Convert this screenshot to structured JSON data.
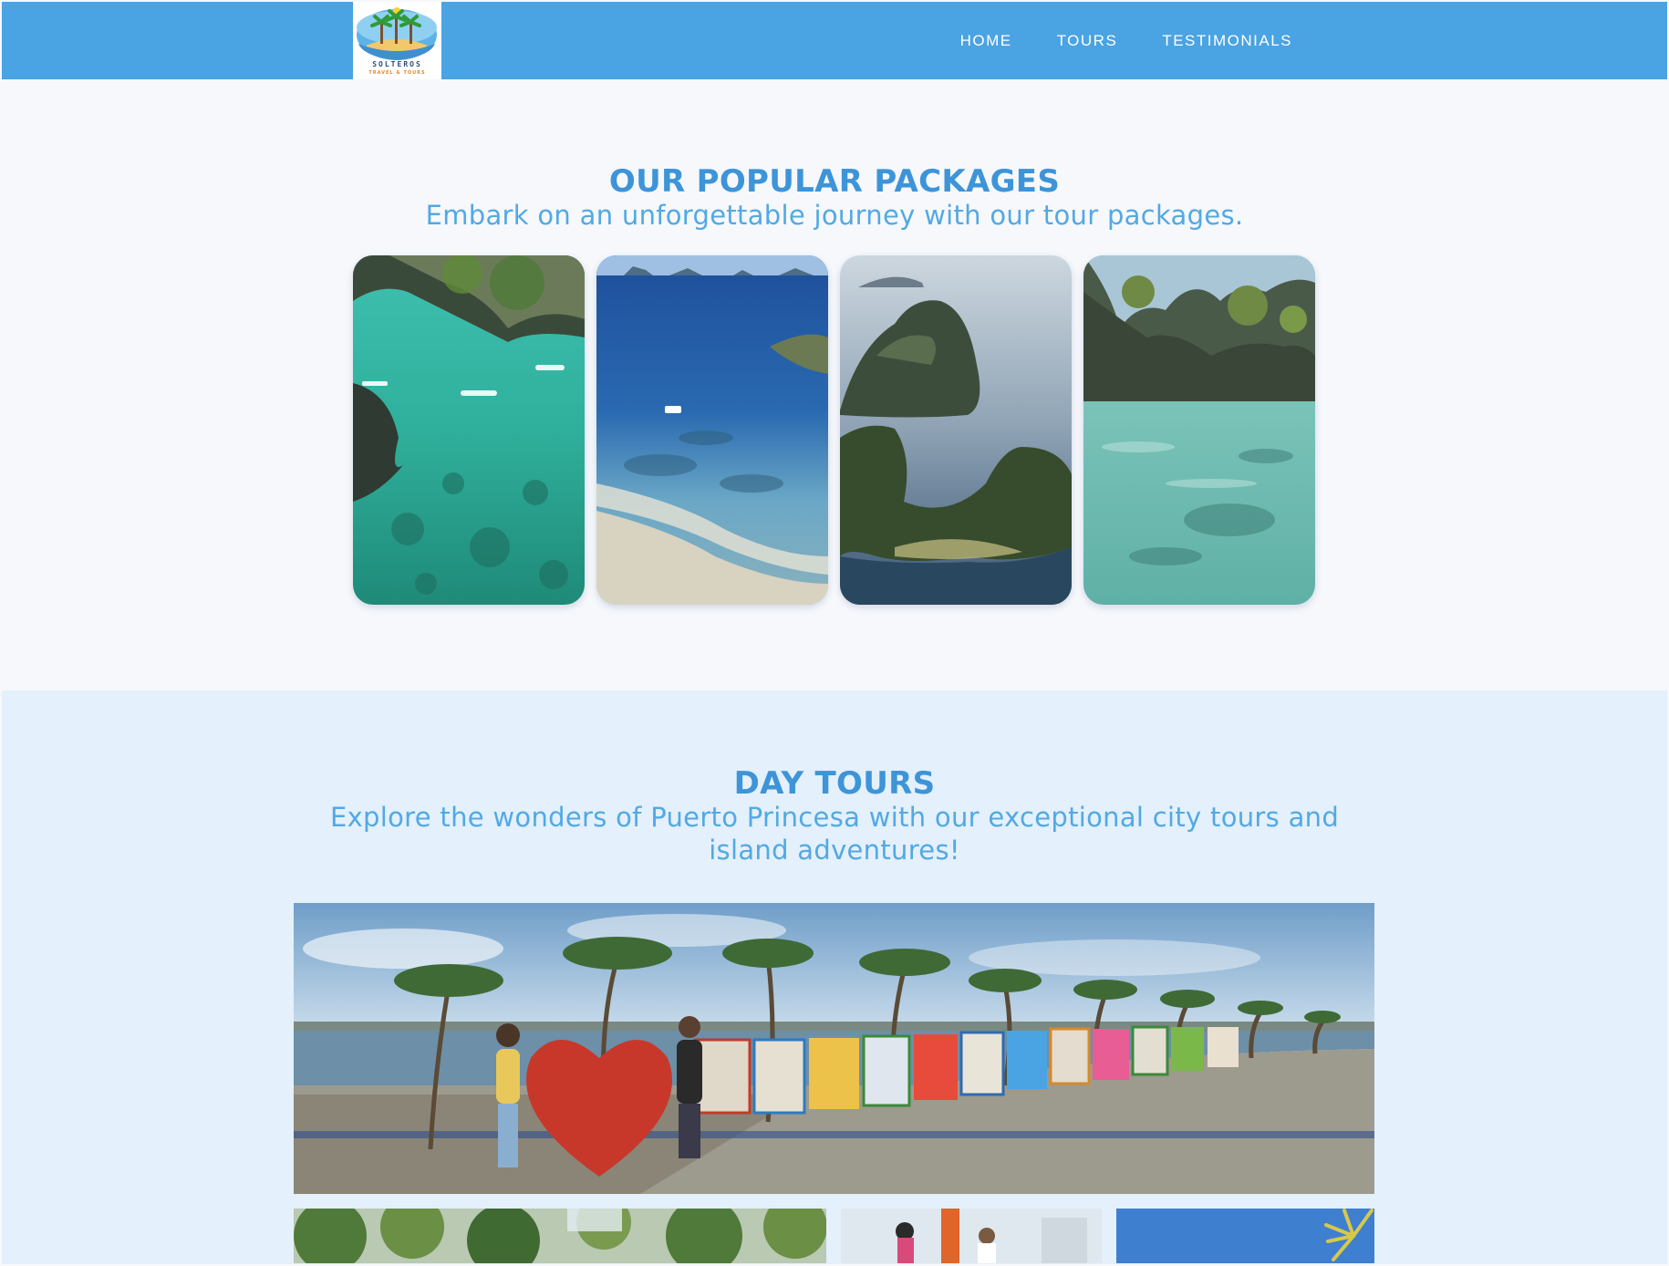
{
  "brand": {
    "logo_alt": "Solteros Travel & Tours logo",
    "logo_name": "SOLTEROS",
    "logo_tagline": "TRAVEL & TOURS"
  },
  "nav": {
    "links": [
      "HOME",
      "TOURS",
      "TESTIMONIALS"
    ]
  },
  "colors": {
    "header": "#4aa3e2",
    "heading": "#3d94d8",
    "subheading": "#52a9e4",
    "page_bg": "#f6f8fc",
    "tours_bg": "#e4f0fc"
  },
  "packages": {
    "title": "OUR POPULAR PACKAGES",
    "subtitle": "Embark on an unforgettable journey with our tour packages.",
    "cards": [
      {
        "image": "lagoon-with-boats-photo"
      },
      {
        "image": "sandbar-aerial-photo"
      },
      {
        "image": "limestone-islands-photo"
      },
      {
        "image": "cliff-lagoon-photo"
      }
    ]
  },
  "day_tours": {
    "title": "DAY TOURS",
    "subtitle": "Explore the wonders of Puerto Princesa with our exceptional city tours and island adventures!",
    "featured_image": "puerto-princesa-baywalk-sign-photo",
    "thumbnails": [
      "forest-trees-photo",
      "zipline-photo",
      "palm-sky-photo"
    ]
  }
}
